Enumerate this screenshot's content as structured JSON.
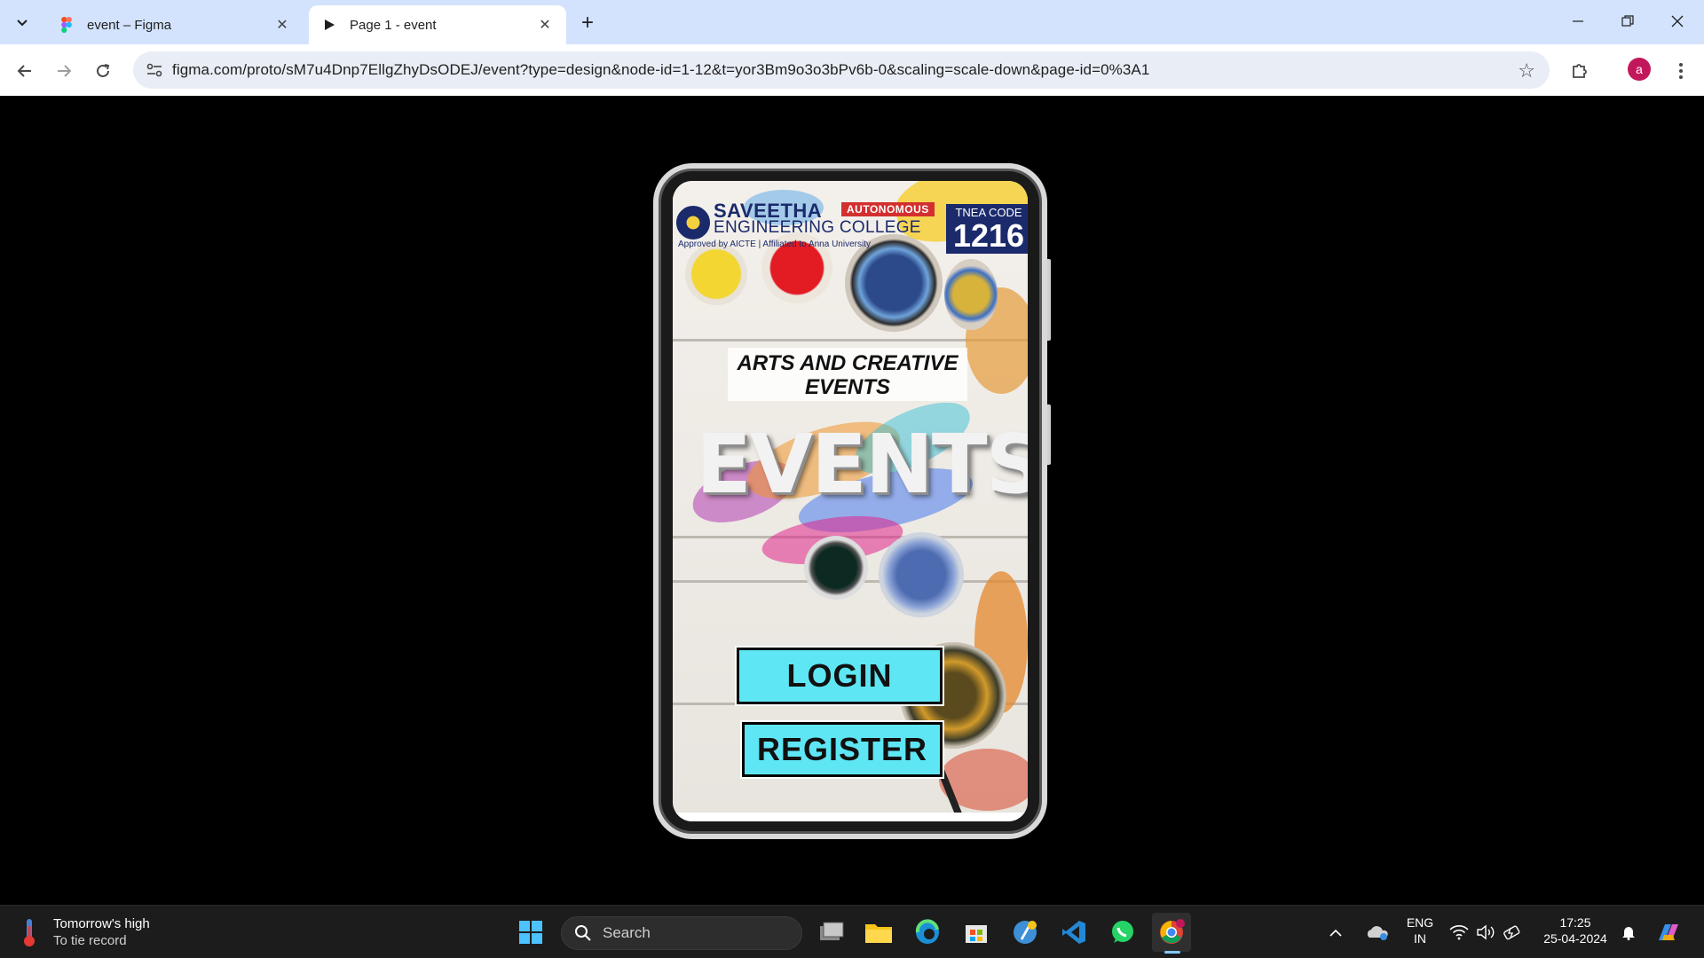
{
  "browser": {
    "tabs": [
      {
        "title": "event – Figma",
        "active": false,
        "icon": "figma-icon"
      },
      {
        "title": "Page 1 - event",
        "active": true,
        "icon": "play-icon"
      }
    ],
    "url": "figma.com/proto/sM7u4Dnp7EllgZhyDsODEJ/event?type=design&node-id=1-12&t=yor3Bm9o3o3bPv6b-0&scaling=scale-down&page-id=0%3A1",
    "profile_initial": "a"
  },
  "app": {
    "college": {
      "name": "SAVEETHA",
      "sub": "ENGINEERING COLLEGE",
      "badge": "AUTONOMOUS",
      "approval": "Approved by AICTE | Affiliated to Anna University",
      "tnea_label": "TNEA CODE",
      "tnea_code": "1216"
    },
    "subtitle": "ARTS AND CREATIVE EVENTS",
    "headline": "EVENTS",
    "login_label": "LOGIN",
    "register_label": "REGISTER",
    "button_color": "#5ee6f4"
  },
  "taskbar": {
    "weather_line1": "Tomorrow's high",
    "weather_line2": "To tie record",
    "search_placeholder": "Search",
    "lang_line1": "ENG",
    "lang_line2": "IN",
    "time": "17:25",
    "date": "25-04-2024",
    "pinned": [
      "windows-start-icon",
      "task-view-icon",
      "file-explorer-icon",
      "edge-icon",
      "microsoft-store-icon",
      "python-idle-icon",
      "vscode-icon",
      "whatsapp-icon",
      "chrome-icon"
    ]
  }
}
